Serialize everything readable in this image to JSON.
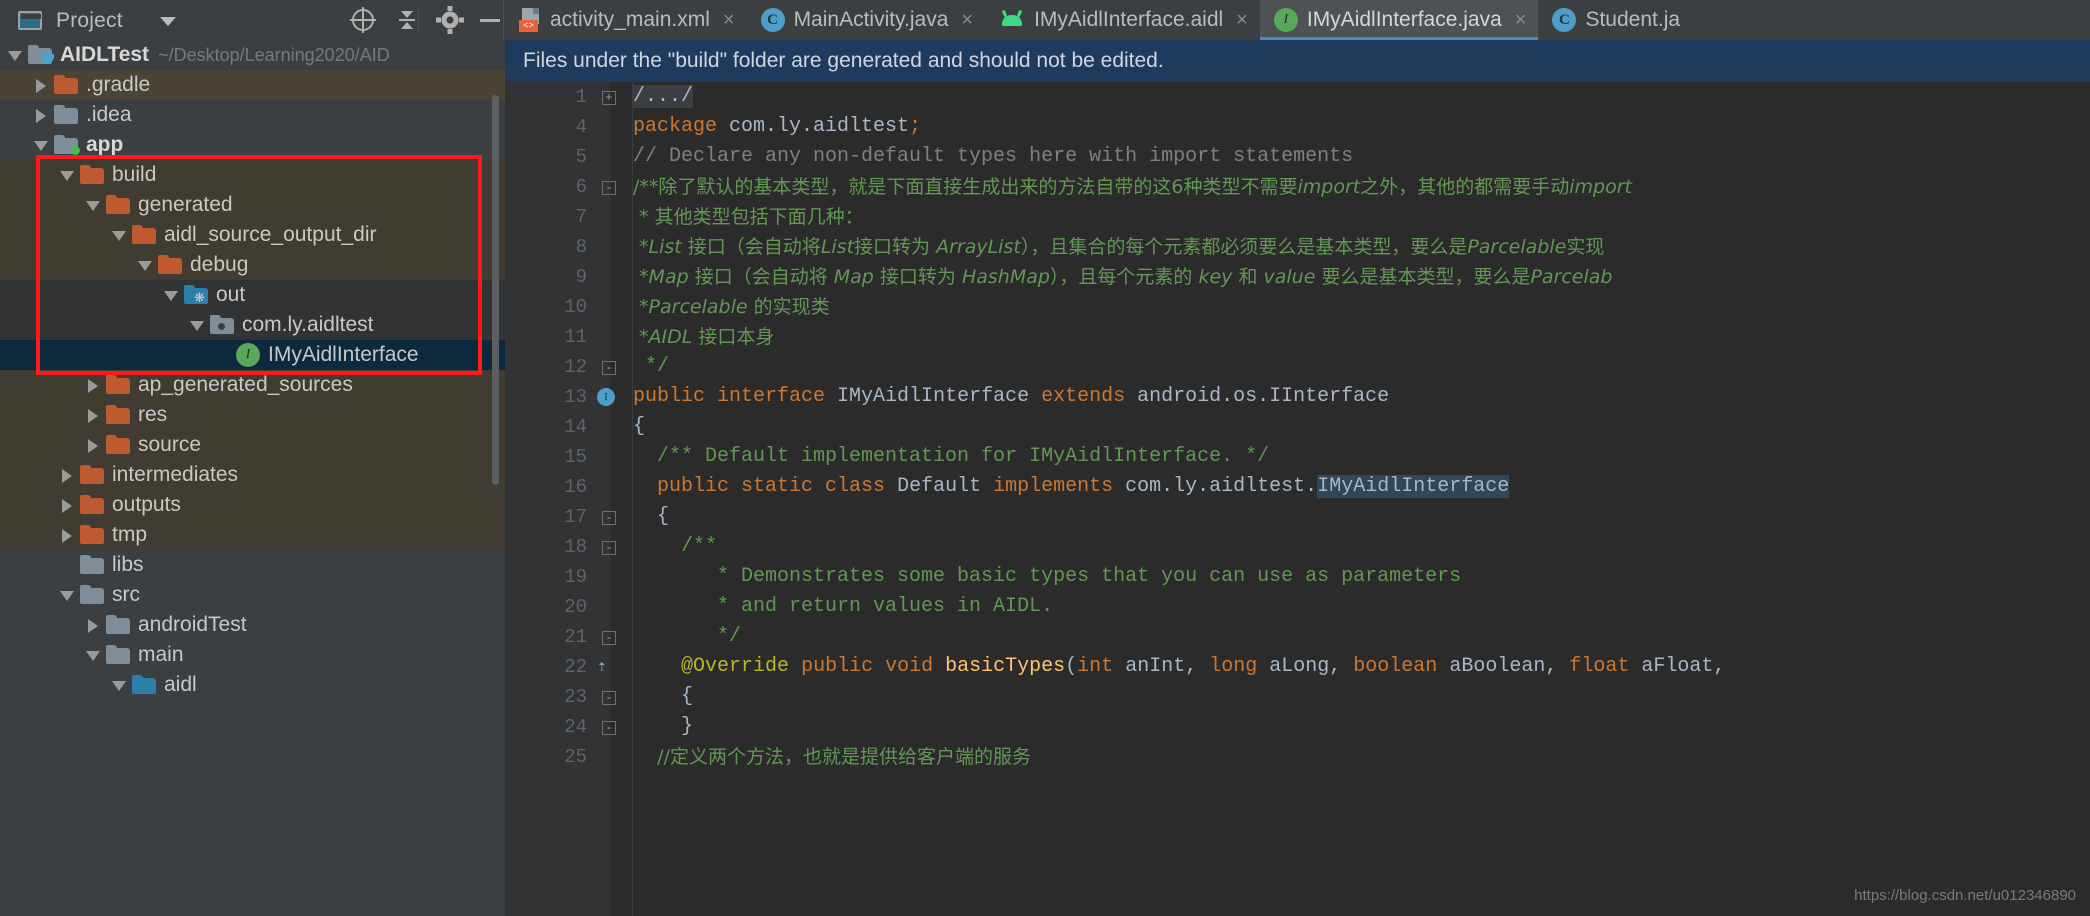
{
  "toolwindow": {
    "title": "Project",
    "icons": [
      "project-window-icon",
      "chevron-down-icon",
      "locate-icon",
      "collapse-all-icon",
      "gear-icon",
      "minimize-icon"
    ]
  },
  "tabs": [
    {
      "label": "activity_main.xml",
      "icon": "xml-layout-icon",
      "active": false,
      "close": "×"
    },
    {
      "label": "MainActivity.java",
      "icon": "java-class-icon",
      "active": false,
      "close": "×"
    },
    {
      "label": "IMyAidlInterface.aidl",
      "icon": "android-aidl-icon",
      "active": false,
      "close": "×"
    },
    {
      "label": "IMyAidlInterface.java",
      "icon": "java-interface-icon",
      "active": true,
      "close": "×"
    },
    {
      "label": "Student.ja",
      "icon": "java-class-icon",
      "active": false,
      "close": ""
    }
  ],
  "tree": [
    {
      "label": "AIDLTest",
      "sub": "~/Desktop/Learning2020/AID",
      "indent": 0,
      "arrow": "down",
      "icon": "module-folder-icon",
      "iconColor": "gray",
      "badge": "cup",
      "bold": true,
      "row": "normal"
    },
    {
      "label": ".gradle",
      "sub": "",
      "indent": 1,
      "arrow": "right",
      "icon": "folder-icon",
      "iconColor": "orange",
      "badge": "",
      "bold": false,
      "row": "hl-gradle"
    },
    {
      "label": ".idea",
      "sub": "",
      "indent": 1,
      "arrow": "right",
      "icon": "folder-icon",
      "iconColor": "gray",
      "badge": "",
      "bold": false,
      "row": "normal"
    },
    {
      "label": "app",
      "sub": "",
      "indent": 1,
      "arrow": "down",
      "icon": "module-folder-icon",
      "iconColor": "gray",
      "badge": "green",
      "bold": true,
      "row": "normal"
    },
    {
      "label": "build",
      "sub": "",
      "indent": 2,
      "arrow": "down",
      "icon": "folder-icon",
      "iconColor": "orange",
      "badge": "",
      "bold": false,
      "row": "inbox"
    },
    {
      "label": "generated",
      "sub": "",
      "indent": 3,
      "arrow": "down",
      "icon": "folder-icon",
      "iconColor": "orange",
      "badge": "",
      "bold": false,
      "row": "inbox"
    },
    {
      "label": "aidl_source_output_dir",
      "sub": "",
      "indent": 4,
      "arrow": "down",
      "icon": "folder-icon",
      "iconColor": "orange",
      "badge": "",
      "bold": false,
      "row": "inbox"
    },
    {
      "label": "debug",
      "sub": "",
      "indent": 5,
      "arrow": "down",
      "icon": "folder-icon",
      "iconColor": "orange",
      "badge": "",
      "bold": false,
      "row": "inbox"
    },
    {
      "label": "out",
      "sub": "",
      "indent": 6,
      "arrow": "down",
      "icon": "generated-source-folder-icon",
      "iconColor": "blue",
      "badge": "gear",
      "bold": false,
      "row": "dark"
    },
    {
      "label": "com.ly.aidltest",
      "sub": "",
      "indent": 7,
      "arrow": "down",
      "icon": "package-icon",
      "iconColor": "gray",
      "badge": "pkg",
      "bold": false,
      "row": "dark"
    },
    {
      "label": "IMyAidlInterface",
      "sub": "",
      "indent": 8,
      "arrow": "none",
      "icon": "java-interface-icon",
      "iconColor": "",
      "badge": "",
      "bold": false,
      "row": "selected"
    },
    {
      "label": "ap_generated_sources",
      "sub": "",
      "indent": 3,
      "arrow": "right",
      "icon": "folder-icon",
      "iconColor": "orange",
      "badge": "",
      "bold": false,
      "row": "inbox"
    },
    {
      "label": "res",
      "sub": "",
      "indent": 3,
      "arrow": "right",
      "icon": "folder-icon",
      "iconColor": "orange",
      "badge": "",
      "bold": false,
      "row": "inbox"
    },
    {
      "label": "source",
      "sub": "",
      "indent": 3,
      "arrow": "right",
      "icon": "folder-icon",
      "iconColor": "orange",
      "badge": "",
      "bold": false,
      "row": "inbox"
    },
    {
      "label": "intermediates",
      "sub": "",
      "indent": 2,
      "arrow": "right",
      "icon": "folder-icon",
      "iconColor": "orange",
      "badge": "",
      "bold": false,
      "row": "inbox"
    },
    {
      "label": "outputs",
      "sub": "",
      "indent": 2,
      "arrow": "right",
      "icon": "folder-icon",
      "iconColor": "orange",
      "badge": "",
      "bold": false,
      "row": "inbox"
    },
    {
      "label": "tmp",
      "sub": "",
      "indent": 2,
      "arrow": "right",
      "icon": "folder-icon",
      "iconColor": "orange",
      "badge": "",
      "bold": false,
      "row": "inbox"
    },
    {
      "label": "libs",
      "sub": "",
      "indent": 2,
      "arrow": "none",
      "icon": "folder-icon",
      "iconColor": "gray",
      "badge": "",
      "bold": false,
      "row": "normal"
    },
    {
      "label": "src",
      "sub": "",
      "indent": 2,
      "arrow": "down",
      "icon": "folder-icon",
      "iconColor": "gray",
      "badge": "",
      "bold": false,
      "row": "normal"
    },
    {
      "label": "androidTest",
      "sub": "",
      "indent": 3,
      "arrow": "right",
      "icon": "folder-icon",
      "iconColor": "gray",
      "badge": "",
      "bold": false,
      "row": "normal"
    },
    {
      "label": "main",
      "sub": "",
      "indent": 3,
      "arrow": "down",
      "icon": "folder-icon",
      "iconColor": "gray",
      "badge": "",
      "bold": false,
      "row": "normal"
    },
    {
      "label": "aidl",
      "sub": "",
      "indent": 4,
      "arrow": "down",
      "icon": "folder-icon",
      "iconColor": "blue",
      "badge": "",
      "bold": false,
      "row": "normal"
    }
  ],
  "editor": {
    "banner": "Files under the \"build\" folder are generated and should not be edited.",
    "watermark": "https://blog.csdn.net/u012346890",
    "lines": [
      {
        "n": "1",
        "fold": "+",
        "gutter": "",
        "html": "<span class=\"foldtxt\">/.../</span>"
      },
      {
        "n": "4",
        "fold": "",
        "gutter": "",
        "html": "<span class=\"kw\">package</span> <span class=\"plain\">com.ly.aidltest</span><span class=\"kw\">;</span>"
      },
      {
        "n": "5",
        "fold": "",
        "gutter": "",
        "html": "<span class=\"cmt\">// Declare any non-default types here with import statements</span>"
      },
      {
        "n": "6",
        "fold": "-",
        "gutter": "",
        "cjk": true,
        "html": "<span class=\"docp\">/**除了默认的基本类型，就是下面直接生成出来的方法自带的这6种类型不需要</span><span class=\"doc\">import</span><span class=\"docp\">之外，其他的都需要手动</span><span class=\"doc\">import</span>"
      },
      {
        "n": "7",
        "fold": "",
        "gutter": "",
        "cjk": true,
        "html": "<span class=\"docp\"> * 其他类型包括下面几种：</span>"
      },
      {
        "n": "8",
        "fold": "",
        "gutter": "",
        "cjk": true,
        "html": "<span class=\"docp\"> *</span><span class=\"doc\">List</span><span class=\"docp\"> 接口（会自动将</span><span class=\"doc\">List</span><span class=\"docp\">接口转为 </span><span class=\"doc\">ArrayList</span><span class=\"docp\">），且集合的每个元素都必须要么是基本类型，要么是</span><span class=\"doc\">Parcelable</span><span class=\"docp\">实现</span>"
      },
      {
        "n": "9",
        "fold": "",
        "gutter": "",
        "cjk": true,
        "html": "<span class=\"docp\"> *</span><span class=\"doc\">Map</span><span class=\"docp\"> 接口（会自动将 </span><span class=\"doc\">Map</span><span class=\"docp\"> 接口转为 </span><span class=\"doc\">HashMap</span><span class=\"docp\">），且每个元素的 </span><span class=\"doc\">key</span><span class=\"docp\"> 和 </span><span class=\"doc\">value</span><span class=\"docp\"> 要么是基本类型，要么是</span><span class=\"doc\">Parcelab</span>"
      },
      {
        "n": "10",
        "fold": "",
        "gutter": "",
        "cjk": true,
        "html": "<span class=\"docp\"> *</span><span class=\"doc\">Parcelable</span><span class=\"docp\"> 的实现类</span>"
      },
      {
        "n": "11",
        "fold": "",
        "gutter": "",
        "cjk": true,
        "html": "<span class=\"docp\"> *</span><span class=\"doc\">AIDL</span><span class=\"docp\"> 接口本身</span>"
      },
      {
        "n": "12",
        "fold": "-",
        "gutter": "",
        "html": "<span class=\"docp\"> */</span>"
      },
      {
        "n": "13",
        "fold": "",
        "gutter": "iface",
        "html": "<span class=\"kw\">public interface</span> <span class=\"plain\">IMyAidlInterface</span> <span class=\"kw\">extends</span> <span class=\"plain\">android.os.IInterface</span>"
      },
      {
        "n": "14",
        "fold": "",
        "gutter": "",
        "html": "<span class=\"plain\">{</span>"
      },
      {
        "n": "15",
        "fold": "",
        "gutter": "",
        "html": "<span class=\"docp\">  /** Default implementation for IMyAidlInterface. */</span>"
      },
      {
        "n": "16",
        "fold": "",
        "gutter": "",
        "html": "<span class=\"plain\">  </span><span class=\"kw\">public static class</span> <span class=\"plain\">Default</span> <span class=\"kw\">implements</span> <span class=\"plain\">com.ly.aidltest.</span><span class=\"plain sel\">IMyAidlInterface</span>"
      },
      {
        "n": "17",
        "fold": "-",
        "gutter": "",
        "html": "<span class=\"plain\">  {</span>"
      },
      {
        "n": "18",
        "fold": "-",
        "gutter": "",
        "html": "<span class=\"docp\">    /**</span>"
      },
      {
        "n": "19",
        "fold": "",
        "gutter": "",
        "html": "<span class=\"docp\">       * Demonstrates some basic types that you can use as parameters</span>"
      },
      {
        "n": "20",
        "fold": "",
        "gutter": "",
        "html": "<span class=\"docp\">       * and return values in AIDL.</span>"
      },
      {
        "n": "21",
        "fold": "-",
        "gutter": "",
        "html": "<span class=\"docp\">       */</span>"
      },
      {
        "n": "22",
        "fold": "",
        "gutter": "override",
        "html": "<span class=\"plain\">    </span><span class=\"anno\">@Override</span> <span class=\"kw\">public void</span> <span class=\"meth\">basicTypes</span><span class=\"plain\">(</span><span class=\"kw\">int</span> <span class=\"plain\">anInt,</span> <span class=\"kw\">long</span> <span class=\"plain\">aLong,</span> <span class=\"kw\">boolean</span> <span class=\"plain\">aBoolean,</span> <span class=\"kw\">float</span> <span class=\"plain\">aFloat,</span>"
      },
      {
        "n": "23",
        "fold": "-",
        "gutter": "",
        "html": "<span class=\"plain\">    {</span>"
      },
      {
        "n": "24",
        "fold": "-",
        "gutter": "",
        "html": "<span class=\"plain\">    }</span>"
      },
      {
        "n": "25",
        "fold": "",
        "gutter": "",
        "cjk": true,
        "html": "<span class=\"docp\">    //定义两个方法，也就是提供给客户端的服务</span>"
      }
    ]
  }
}
